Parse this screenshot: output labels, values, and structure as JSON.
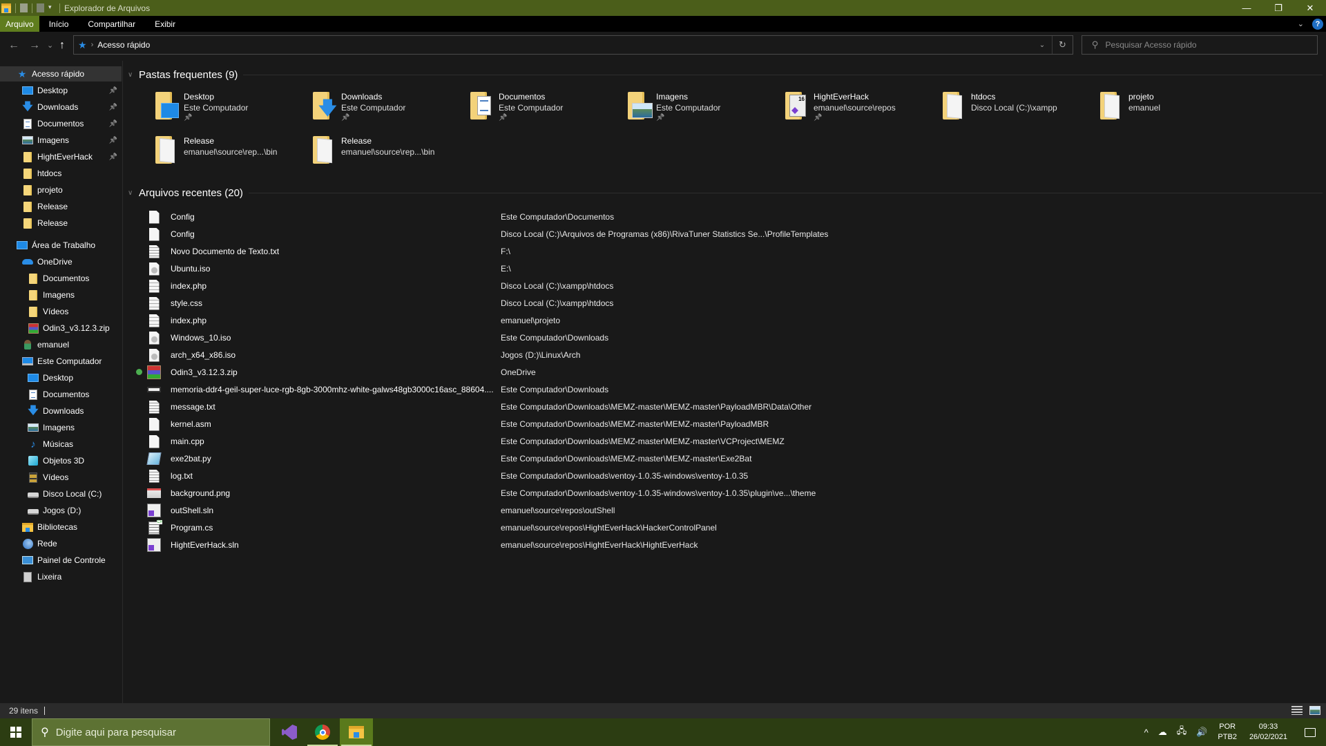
{
  "window": {
    "title": "Explorador de Arquivos",
    "controls": {
      "minimize": "—",
      "maximize": "❐",
      "close": "✕"
    }
  },
  "ribbon": {
    "tabs": [
      {
        "label": "Arquivo",
        "active": true
      },
      {
        "label": "Início"
      },
      {
        "label": "Compartilhar"
      },
      {
        "label": "Exibir"
      }
    ],
    "help_label": "?"
  },
  "nav": {
    "back": "←",
    "forward": "→",
    "recent": "⌄",
    "up": "↑",
    "breadcrumb": [
      "Acesso rápido"
    ],
    "search_placeholder": "Pesquisar Acesso rápido"
  },
  "sidebar": {
    "items": [
      {
        "label": "Acesso rápido",
        "icon": "star-icon",
        "level": 1,
        "selected": true
      },
      {
        "label": "Desktop",
        "icon": "desktop-icon",
        "level": 2,
        "pinned": true
      },
      {
        "label": "Downloads",
        "icon": "downloads-icon",
        "level": 2,
        "pinned": true
      },
      {
        "label": "Documentos",
        "icon": "documents-icon",
        "level": 2,
        "pinned": true
      },
      {
        "label": "Imagens",
        "icon": "pictures-icon",
        "level": 2,
        "pinned": true
      },
      {
        "label": "HightEverHack",
        "icon": "folder-icon",
        "level": 2,
        "pinned": true
      },
      {
        "label": "htdocs",
        "icon": "folder-icon",
        "level": 2
      },
      {
        "label": "projeto",
        "icon": "folder-icon",
        "level": 2
      },
      {
        "label": "Release",
        "icon": "folder-icon",
        "level": 2
      },
      {
        "label": "Release",
        "icon": "folder-icon",
        "level": 2
      },
      {
        "label": "Área de Trabalho",
        "icon": "desktop-icon",
        "level": 1
      },
      {
        "label": "OneDrive",
        "icon": "onedrive-icon",
        "level": 2
      },
      {
        "label": "Documentos",
        "icon": "folder-icon",
        "level": 3
      },
      {
        "label": "Imagens",
        "icon": "folder-icon",
        "level": 3
      },
      {
        "label": "Vídeos",
        "icon": "folder-icon",
        "level": 3
      },
      {
        "label": "Odin3_v3.12.3.zip",
        "icon": "zip-icon",
        "level": 3
      },
      {
        "label": "emanuel",
        "icon": "user-icon",
        "level": 2
      },
      {
        "label": "Este Computador",
        "icon": "pc-icon",
        "level": 2
      },
      {
        "label": "Desktop",
        "icon": "desktop-icon",
        "level": 3
      },
      {
        "label": "Documentos",
        "icon": "documents-icon",
        "level": 3
      },
      {
        "label": "Downloads",
        "icon": "downloads-icon",
        "level": 3
      },
      {
        "label": "Imagens",
        "icon": "pictures-icon",
        "level": 3
      },
      {
        "label": "Músicas",
        "icon": "music-icon",
        "level": 3
      },
      {
        "label": "Objetos 3D",
        "icon": "3d-objects-icon",
        "level": 3
      },
      {
        "label": "Vídeos",
        "icon": "videos-icon",
        "level": 3
      },
      {
        "label": "Disco Local (C:)",
        "icon": "drive-icon",
        "level": 3
      },
      {
        "label": "Jogos (D:)",
        "icon": "drive-icon",
        "level": 3
      },
      {
        "label": "Bibliotecas",
        "icon": "libraries-icon",
        "level": 2
      },
      {
        "label": "Rede",
        "icon": "network-icon",
        "level": 2
      },
      {
        "label": "Painel de Controle",
        "icon": "control-panel-icon",
        "level": 2
      },
      {
        "label": "Lixeira",
        "icon": "recycle-bin-icon",
        "level": 2
      }
    ]
  },
  "frequent": {
    "title": "Pastas frequentes (9)",
    "folders": [
      {
        "name": "Desktop",
        "location": "Este Computador",
        "pinned": true,
        "overlay": "desktop"
      },
      {
        "name": "Downloads",
        "location": "Este Computador",
        "pinned": true,
        "overlay": "downloads"
      },
      {
        "name": "Documentos",
        "location": "Este Computador",
        "pinned": true,
        "overlay": "documents"
      },
      {
        "name": "Imagens",
        "location": "Este Computador",
        "pinned": true,
        "overlay": "pictures"
      },
      {
        "name": "HightEverHack",
        "location": "emanuel\\source\\repos",
        "pinned": true,
        "overlay": "visual-studio"
      },
      {
        "name": "htdocs",
        "location": "Disco Local (C:)\\xampp",
        "pinned": false,
        "overlay": "paper"
      },
      {
        "name": "projeto",
        "location": "emanuel",
        "pinned": false,
        "overlay": "paper"
      },
      {
        "name": "Release",
        "location": "emanuel\\source\\rep...\\bin",
        "pinned": false,
        "overlay": "paper"
      },
      {
        "name": "Release",
        "location": "emanuel\\source\\rep...\\bin",
        "pinned": false,
        "overlay": "paper"
      }
    ]
  },
  "recent": {
    "title": "Arquivos recentes (20)",
    "files": [
      {
        "name": "Config",
        "path": "Este Computador\\Documentos",
        "type": "blank"
      },
      {
        "name": "Config",
        "path": "Disco Local (C:)\\Arquivos de Programas (x86)\\RivaTuner Statistics Se...\\ProfileTemplates",
        "type": "blank"
      },
      {
        "name": "Novo Documento de Texto.txt",
        "path": "F:\\",
        "type": "text"
      },
      {
        "name": "Ubuntu.iso",
        "path": "E:\\",
        "type": "iso"
      },
      {
        "name": "index.php",
        "path": "Disco Local (C:)\\xampp\\htdocs",
        "type": "code"
      },
      {
        "name": "style.css",
        "path": "Disco Local (C:)\\xampp\\htdocs",
        "type": "code"
      },
      {
        "name": "index.php",
        "path": "emanuel\\projeto",
        "type": "code"
      },
      {
        "name": "Windows_10.iso",
        "path": "Este Computador\\Downloads",
        "type": "iso"
      },
      {
        "name": "arch_x64_x86.iso",
        "path": "Jogos (D:)\\Linux\\Arch",
        "type": "iso"
      },
      {
        "name": "Odin3_v3.12.3.zip",
        "path": "OneDrive",
        "type": "zip",
        "synced": true
      },
      {
        "name": "memoria-ddr4-geil-super-luce-rgb-8gb-3000mhz-white-galws48gb3000c16asc_88604....",
        "path": "Este Computador\\Downloads",
        "type": "jpg"
      },
      {
        "name": "message.txt",
        "path": "Este Computador\\Downloads\\MEMZ-master\\MEMZ-master\\PayloadMBR\\Data\\Other",
        "type": "text"
      },
      {
        "name": "kernel.asm",
        "path": "Este Computador\\Downloads\\MEMZ-master\\MEMZ-master\\PayloadMBR",
        "type": "blank"
      },
      {
        "name": "main.cpp",
        "path": "Este Computador\\Downloads\\MEMZ-master\\MEMZ-master\\VCProject\\MEMZ",
        "type": "blank"
      },
      {
        "name": "exe2bat.py",
        "path": "Este Computador\\Downloads\\MEMZ-master\\MEMZ-master\\Exe2Bat",
        "type": "py"
      },
      {
        "name": "log.txt",
        "path": "Este Computador\\Downloads\\ventoy-1.0.35-windows\\ventoy-1.0.35",
        "type": "text"
      },
      {
        "name": "background.png",
        "path": "Este Computador\\Downloads\\ventoy-1.0.35-windows\\ventoy-1.0.35\\plugin\\ve...\\theme",
        "type": "png"
      },
      {
        "name": "outShell.sln",
        "path": "emanuel\\source\\repos\\outShell",
        "type": "sln"
      },
      {
        "name": "Program.cs",
        "path": "emanuel\\source\\repos\\HightEverHack\\HackerControlPanel",
        "type": "cs"
      },
      {
        "name": "HightEverHack.sln",
        "path": "emanuel\\source\\repos\\HightEverHack\\HightEverHack",
        "type": "sln"
      }
    ]
  },
  "status": {
    "item_count": "29 itens"
  },
  "taskbar": {
    "search_placeholder": "Digite aqui para pesquisar",
    "apps": [
      {
        "name": "Visual Studio",
        "icon": "visual-studio-icon"
      },
      {
        "name": "Google Chrome",
        "icon": "chrome-icon"
      },
      {
        "name": "Explorador de Arquivos",
        "icon": "file-explorer-icon",
        "active": true
      }
    ],
    "tray": {
      "language": "POR",
      "layout": "PTB2",
      "time": "09:33",
      "date": "26/02/2021"
    }
  },
  "colors": {
    "titlebar": "#4b5e1a",
    "ribbon_active_tab": "#5f7d1e",
    "taskbar": "#2c3d12",
    "taskbar_search": "#5d7233",
    "background": "#191919",
    "accent_blue": "#2a8de6"
  }
}
